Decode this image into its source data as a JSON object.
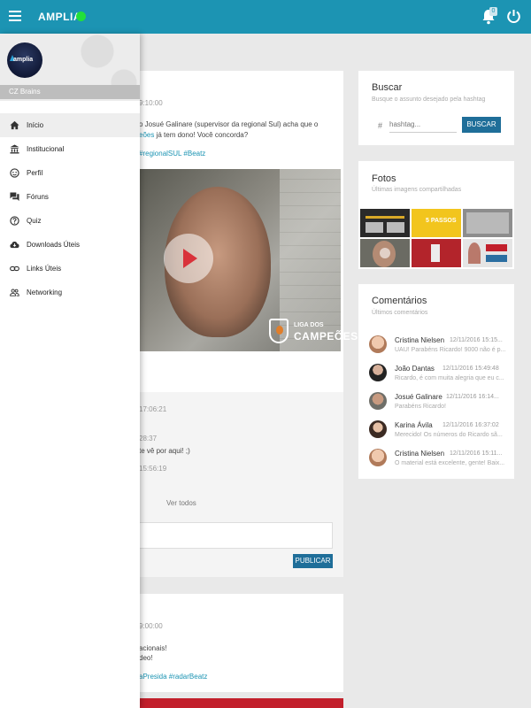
{
  "topbar": {
    "app_name": "AMPLIA",
    "notifications_count": "0",
    "online_color": "#22e03a",
    "bar_color": "#1c94b3"
  },
  "drawer": {
    "logo_text": "amplia",
    "user_name": "CZ Brains",
    "items": [
      {
        "label": "Início",
        "icon": "home-icon"
      },
      {
        "label": "Institucional",
        "icon": "institution-icon"
      },
      {
        "label": "Perfil",
        "icon": "face-icon"
      },
      {
        "label": "Fóruns",
        "icon": "forum-icon"
      },
      {
        "label": "Quiz",
        "icon": "help-icon"
      },
      {
        "label": "Downloads Úteis",
        "icon": "cloud-download-icon"
      },
      {
        "label": "Links Úteis",
        "icon": "link-icon"
      },
      {
        "label": "Networking",
        "icon": "people-icon"
      }
    ]
  },
  "post1": {
    "time": "9:10:00",
    "text_line1": "o Josué Galinare (supervisor da regional Sul) acha que o",
    "text_line2_link": "eões",
    "text_line2_rest": " já tem dono! Você concorda?",
    "hashtags": "#regionalSUL #Beatz",
    "video_brand_line1": "LIGA DOS",
    "video_brand_line2": "CAMPEÕES",
    "comment_times": [
      "17:06:21",
      "28:37",
      "15:56:19"
    ],
    "comment_text": "te vê por aqui! ;)",
    "view_all": "Ver todos",
    "publish_button": "PUBLICAR"
  },
  "post2": {
    "time": "9:00:00",
    "text_line1": "acionais!",
    "text_line2": "deo!",
    "hashtags": "aPresida #radarBeatz"
  },
  "search": {
    "title": "Buscar",
    "subtitle": "Busque o assunto desejado pela hashtag",
    "hash_symbol": "#",
    "placeholder": "hashtag...",
    "button": "BUSCAR"
  },
  "photos": {
    "title": "Fotos",
    "subtitle": "Últimas imagens compartilhadas",
    "tile_caption": "5 PASSOS"
  },
  "comments": {
    "title": "Comentários",
    "subtitle": "Últimos comentários",
    "items": [
      {
        "name": "Cristina Nielsen",
        "date": "12/11/2016 15:15...",
        "text": "UAU! Parabéns Ricardo! 9000 não é p..."
      },
      {
        "name": "João Dantas",
        "date": "12/11/2016 15:49:48",
        "text": "Ricardo, é com muita alegria que eu c..."
      },
      {
        "name": "Josué Galinare",
        "date": "12/11/2016 16:14...",
        "text": "Parabéns Ricardo!"
      },
      {
        "name": "Karina Ávila",
        "date": "12/11/2016 16:37:02",
        "text": "Merecido! Os números do Ricardo sã..."
      },
      {
        "name": "Cristina Nielsen",
        "date": "12/11/2016 15:11...",
        "text": "O material está excelente, gente! Baix..."
      }
    ]
  }
}
